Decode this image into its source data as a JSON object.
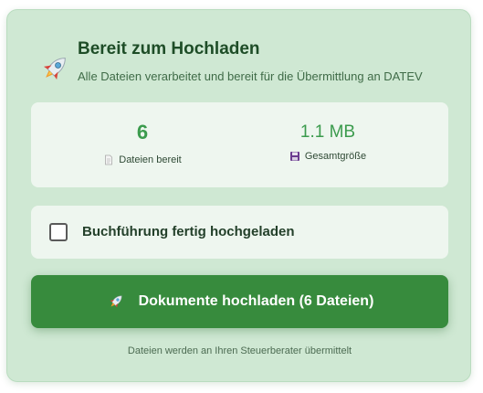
{
  "header": {
    "icon": "rocket-icon",
    "title": "Bereit zum Hochladen",
    "subtitle": "Alle Dateien verarbeitet und bereit für die Übermittlung an DATEV"
  },
  "stats": {
    "files": {
      "value": "6",
      "label": "Dateien bereit",
      "icon": "document-icon"
    },
    "size": {
      "value": "1.1 MB",
      "label": "Gesamtgröße",
      "icon": "floppy-disk-icon"
    }
  },
  "confirm": {
    "label": "Buchführung fertig hochgeladen",
    "checked": false
  },
  "upload_button": {
    "label": "Dokumente hochladen (6 Dateien)",
    "icon": "rocket-icon"
  },
  "footnote": "Dateien werden an Ihren Steuerberater übermittelt",
  "colors": {
    "card_bg": "#cfe8d3",
    "title": "#1e4d27",
    "accent_green": "#3b9b4d",
    "button_bg": "#378b3d"
  }
}
